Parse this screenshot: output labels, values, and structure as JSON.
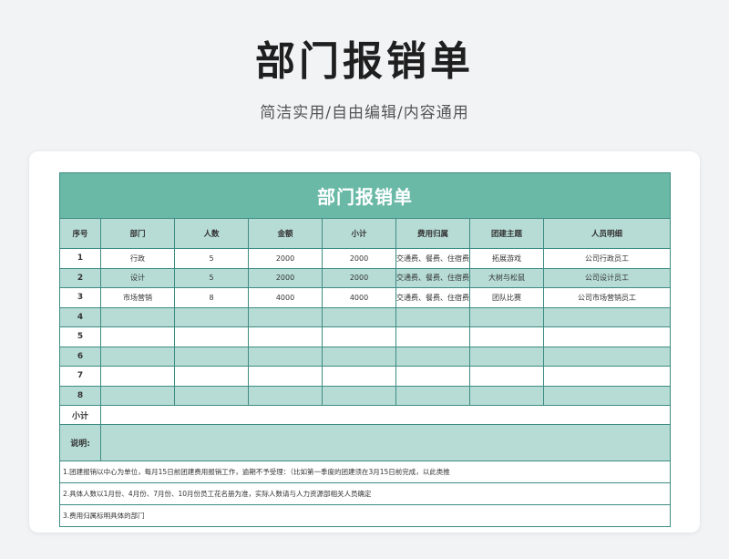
{
  "page": {
    "title": "部门报销单",
    "subtitle": "简洁实用/自由编辑/内容通用"
  },
  "table": {
    "title": "部门报销单",
    "headers": [
      "序号",
      "部门",
      "人数",
      "金额",
      "小计",
      "费用归属",
      "团建主题",
      "人员明细"
    ],
    "rows": [
      [
        "1",
        "行政",
        "5",
        "2000",
        "2000",
        "交通费、餐费、住宿费",
        "拓展游戏",
        "公司行政员工"
      ],
      [
        "2",
        "设计",
        "5",
        "2000",
        "2000",
        "交通费、餐费、住宿费",
        "大树与松鼠",
        "公司设计员工"
      ],
      [
        "3",
        "市场营销",
        "8",
        "4000",
        "4000",
        "交通费、餐费、住宿费",
        "团队比赛",
        "公司市场营销员工"
      ],
      [
        "4",
        "",
        "",
        "",
        "",
        "",
        "",
        ""
      ],
      [
        "5",
        "",
        "",
        "",
        "",
        "",
        "",
        ""
      ],
      [
        "6",
        "",
        "",
        "",
        "",
        "",
        "",
        ""
      ],
      [
        "7",
        "",
        "",
        "",
        "",
        "",
        "",
        ""
      ],
      [
        "8",
        "",
        "",
        "",
        "",
        "",
        "",
        ""
      ]
    ],
    "subtotal_label": "小计",
    "subtotal_value": "",
    "notes_label": "说明:",
    "notes_value": "",
    "notes": [
      "1.团建报销以中心为单位，每月15日前团建费用报销工作，逾期不予受理：（比如第一季度的团建须在3月15日前完成，以此类推",
      "2.具体人数以1月份、4月份、7月份、10月份员工花名册为准，实际人数请与人力资源部相关人员确定",
      "3.费用归属标明具体的部门"
    ]
  },
  "colors": {
    "title_band": "#6ab9a7",
    "alt_row": "#b7dcd6",
    "border": "#3d8c83"
  }
}
